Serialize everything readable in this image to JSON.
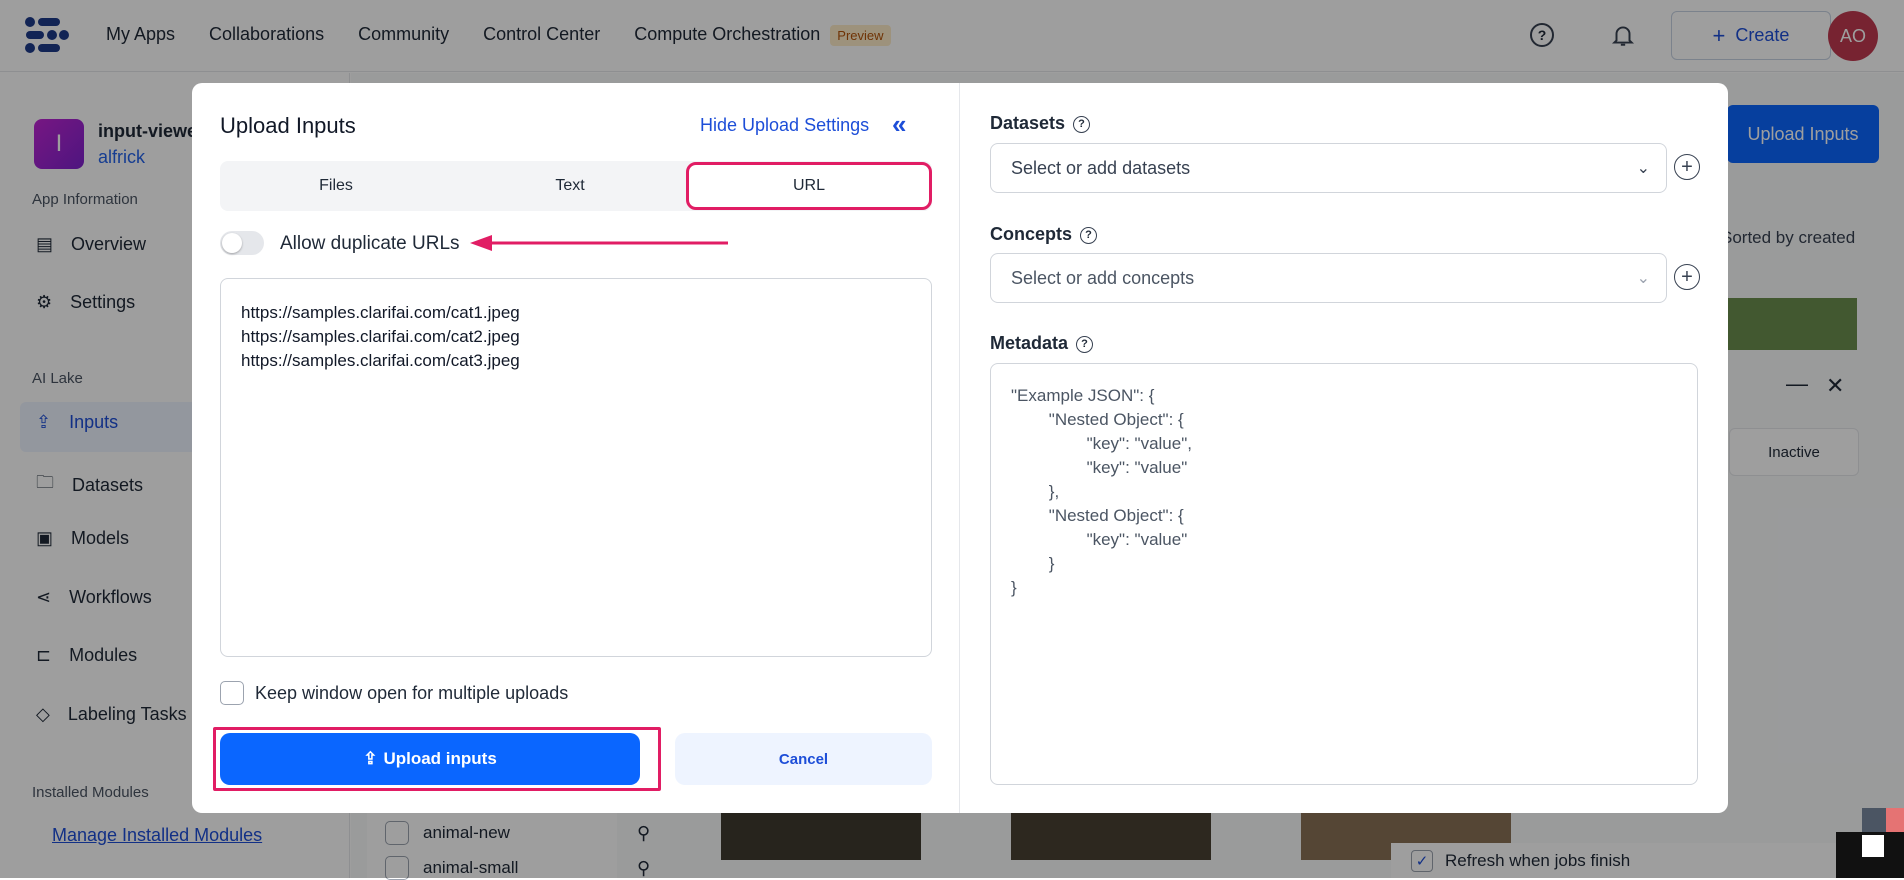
{
  "topnav": {
    "links": [
      "My Apps",
      "Collaborations",
      "Community",
      "Control Center",
      "Compute Orchestration"
    ],
    "preview_badge": "Preview",
    "create_label": "Create",
    "avatar_initials": "AO"
  },
  "sidebar": {
    "app_initial": "I",
    "app_name": "input-viewe",
    "app_owner": "alfrick",
    "section_app_info": "App Information",
    "overview": "Overview",
    "settings": "Settings",
    "section_ai_lake": "AI Lake",
    "inputs": "Inputs",
    "datasets": "Datasets",
    "models": "Models",
    "workflows": "Workflows",
    "modules": "Modules",
    "labeling_tasks": "Labeling Tasks",
    "section_installed": "Installed Modules",
    "manage_modules": "Manage Installed Modules"
  },
  "background": {
    "upload_inputs_btn": "Upload Inputs",
    "sorted_by": "Sorted by created",
    "inactive_tab": "Inactive",
    "dataset_rows": [
      "animal-new",
      "animal-small"
    ],
    "refresh_label": "Refresh when jobs finish"
  },
  "modal": {
    "title": "Upload Inputs",
    "hide_settings": "Hide Upload Settings",
    "tabs": [
      "Files",
      "Text",
      "URL"
    ],
    "active_tab": "URL",
    "allow_duplicate": "Allow duplicate URLs",
    "urls": "https://samples.clarifai.com/cat1.jpeg\nhttps://samples.clarifai.com/cat2.jpeg\nhttps://samples.clarifai.com/cat3.jpeg",
    "keep_open": "Keep window open for multiple uploads",
    "upload_btn": "Upload inputs",
    "cancel_btn": "Cancel",
    "datasets_label": "Datasets",
    "datasets_placeholder": "Select or add datasets",
    "concepts_label": "Concepts",
    "concepts_placeholder": "Select or add concepts",
    "metadata_label": "Metadata",
    "metadata_placeholder": "\"Example JSON\": {\n        \"Nested Object\": {\n                \"key\": \"value\",\n                \"key\": \"value\"\n        },\n        \"Nested Object\": {\n                \"key\": \"value\"\n        }\n}"
  },
  "colors": {
    "accent": "#0a66ff",
    "highlight": "#e11d64",
    "avatar": "#c0394f"
  }
}
